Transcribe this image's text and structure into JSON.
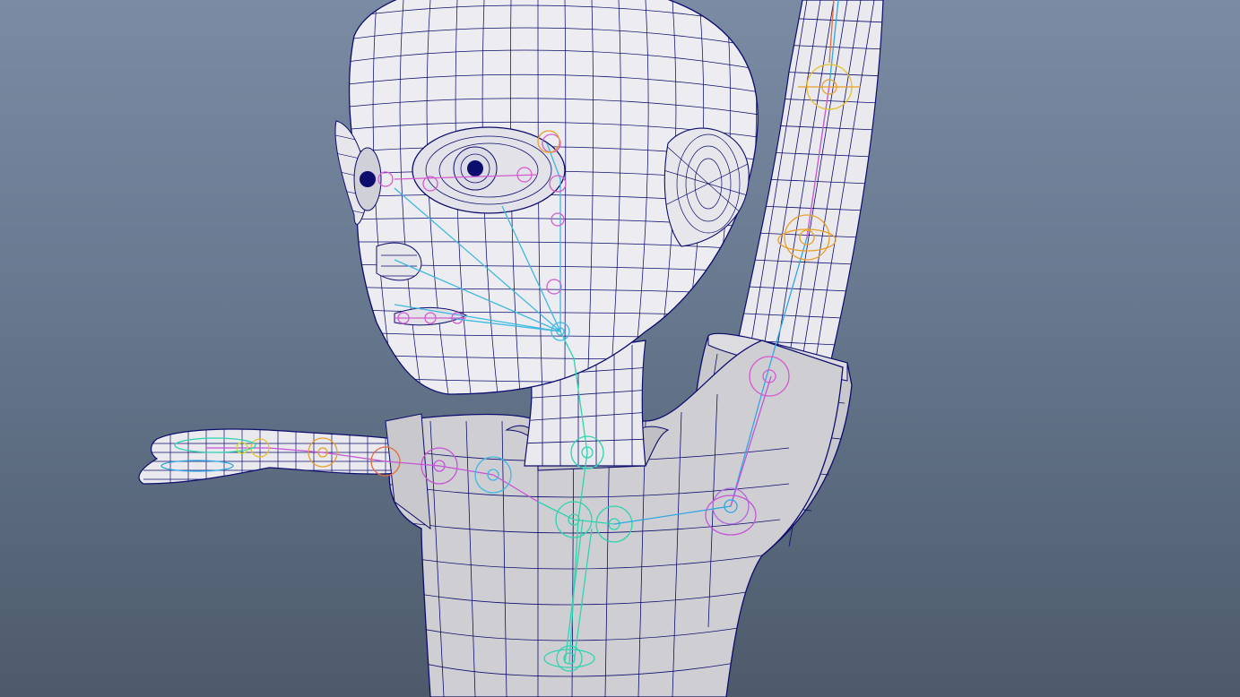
{
  "viewport": {
    "background_top": "#7a8ba3",
    "background_bottom": "#4d5a6b",
    "wire_color": "#0d0d6e",
    "mesh_fill": "#e9e9ee",
    "shirt_fill": "#cfcfd3"
  },
  "rig": {
    "spine_color": "#2fd3b0",
    "arm_left_color": "#c654d6",
    "arm_right_color": "#2fa7e0",
    "forearm_color": "#e8a02a",
    "face_color": "#3fb8e0",
    "lip_color": "#d45bd0"
  },
  "icons": [
    "joint-icon"
  ]
}
